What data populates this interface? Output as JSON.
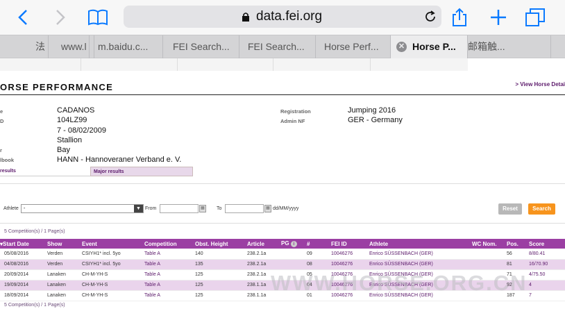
{
  "browser": {
    "url": "data.fei.org",
    "tabs": [
      {
        "label": "法"
      },
      {
        "label": "www.l"
      },
      {
        "label": "m.baidu.c..."
      },
      {
        "label": "FEI Search..."
      },
      {
        "label": "FEI Search..."
      },
      {
        "label": "Horse Perf..."
      },
      {
        "label": "Horse P..."
      },
      {
        "label": "邮箱触..."
      }
    ]
  },
  "page": {
    "title": "ORSE PERFORMANCE",
    "view_link": "> View Horse Detai"
  },
  "horse_info": {
    "left_labels": [
      "e",
      "D",
      "",
      "",
      "r",
      "lbook"
    ],
    "left_values": [
      "CADANOS",
      "104LZ99",
      "7 - 08/02/2009",
      "Stallion",
      "Bay",
      "HANN - Hannoveraner Verband e. V."
    ],
    "right_labels": [
      "Registration",
      "Admin NF"
    ],
    "right_values": [
      "Jumping 2016",
      "GER - Germany"
    ]
  },
  "result_tabs": [
    "results",
    "Major results"
  ],
  "filters": {
    "athlete_label": "Athlete",
    "athlete_value": "-",
    "from_label": "From",
    "to_label": "To",
    "date_format": "dd/MM/yyyy",
    "reset_label": "Reset",
    "search_label": "Search"
  },
  "count_text": "5 Competition(s) / 1 Page(s)",
  "table": {
    "headers": [
      "Start Date",
      "Show",
      "Event",
      "Competition",
      "Obst. Height",
      "Article",
      "PG",
      "#",
      "FEI ID",
      "Athlete",
      "WC Nom.",
      "Pos.",
      "Score"
    ],
    "rows": [
      [
        "05/08/2016",
        "Verden",
        "CSIYH1* incl. 5yo",
        "Table A",
        "140",
        "238.2.1a",
        "",
        "09",
        "10046276",
        "Enrico SÜSSENBACH (GER)",
        "",
        "56",
        "8/80.41"
      ],
      [
        "04/08/2016",
        "Verden",
        "CSIYH1* incl. 5yo",
        "Table A",
        "135",
        "238.2.1a",
        "",
        "08",
        "10046276",
        "Enrico SÜSSENBACH (GER)",
        "",
        "81",
        "16/70.90"
      ],
      [
        "20/09/2014",
        "Lanaken",
        "CH-M-YH-S",
        "Table A",
        "125",
        "238.2.1a",
        "",
        "05",
        "10046276",
        "Enrico SÜSSENBACH (GER)",
        "",
        "71",
        "4/75.50"
      ],
      [
        "19/09/2014",
        "Lanaken",
        "CH-M-YH-S",
        "Table A",
        "125",
        "238.1.1a",
        "",
        "04",
        "10046276",
        "Enrico SÜSSENBACH (GER)",
        "",
        "92",
        "4"
      ],
      [
        "18/09/2014",
        "Lanaken",
        "CH-M-YH-S",
        "Table A",
        "125",
        "238.1.1a",
        "",
        "01",
        "10046276",
        "Enrico SÜSSENBACH (GER)",
        "",
        "187",
        "7"
      ]
    ]
  },
  "watermark": "WWW.HORSE.ORG.CN",
  "colors": {
    "accent_purple": "#9b3fa3",
    "search_orange": "#f7941d",
    "browser_blue": "#0a7aff"
  }
}
